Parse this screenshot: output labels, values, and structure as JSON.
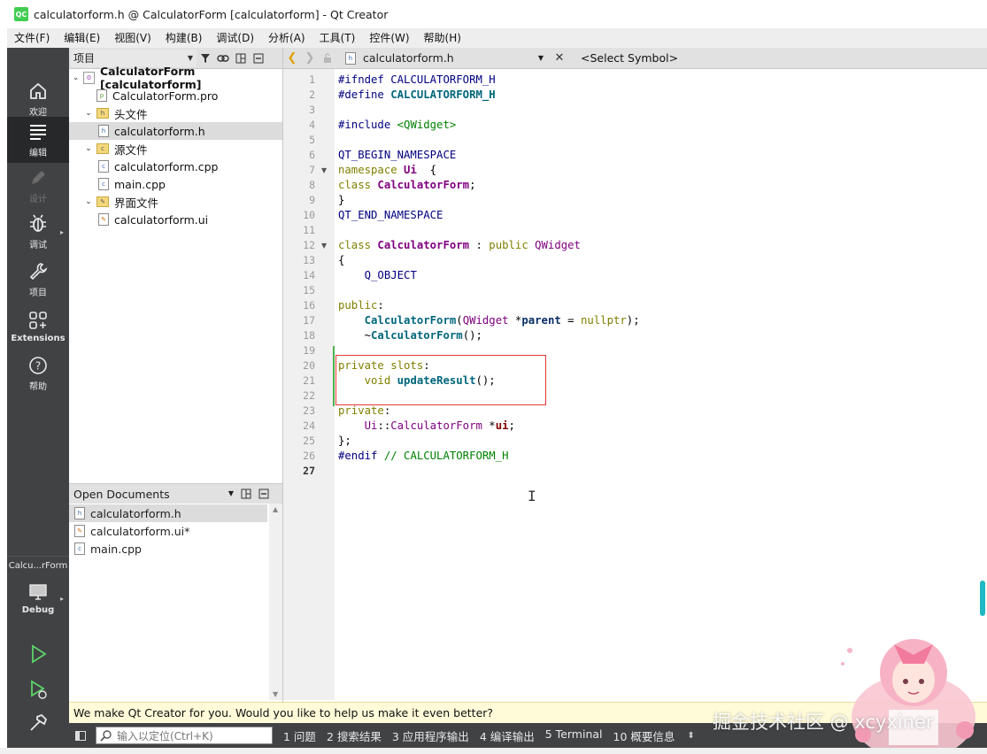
{
  "window": {
    "logo": "QC",
    "title": "calculatorform.h @ CalculatorForm [calculatorform] - Qt Creator"
  },
  "menu": [
    "文件(F)",
    "编辑(E)",
    "视图(V)",
    "构建(B)",
    "调试(D)",
    "分析(A)",
    "工具(T)",
    "控件(W)",
    "帮助(H)"
  ],
  "modes": {
    "welcome": "欢迎",
    "edit": "编辑",
    "design": "设计",
    "debug": "调试",
    "projects": "项目",
    "extensions": "Extensions",
    "help": "帮助"
  },
  "target": {
    "name": "Calcu...rForm",
    "config": "Debug"
  },
  "projects_panel": {
    "title": "项目",
    "tree": [
      {
        "label": "CalculatorForm [calculatorform]",
        "level": 0,
        "kind": "project",
        "expanded": true
      },
      {
        "label": "CalculatorForm.pro",
        "level": 1,
        "kind": "pro"
      },
      {
        "label": "头文件",
        "level": 1,
        "kind": "folder",
        "expanded": true
      },
      {
        "label": "calculatorform.h",
        "level": 2,
        "kind": "h",
        "selected": true
      },
      {
        "label": "源文件",
        "level": 1,
        "kind": "folder",
        "expanded": true
      },
      {
        "label": "calculatorform.cpp",
        "level": 2,
        "kind": "cpp"
      },
      {
        "label": "main.cpp",
        "level": 2,
        "kind": "cpp"
      },
      {
        "label": "界面文件",
        "level": 1,
        "kind": "folder",
        "expanded": true
      },
      {
        "label": "calculatorform.ui",
        "level": 2,
        "kind": "ui"
      }
    ]
  },
  "open_documents": {
    "title": "Open Documents",
    "items": [
      {
        "label": "calculatorform.h",
        "kind": "h",
        "selected": true
      },
      {
        "label": "calculatorform.ui*",
        "kind": "ui"
      },
      {
        "label": "main.cpp",
        "kind": "cpp"
      }
    ]
  },
  "editor_toolbar": {
    "file": "calculatorform.h",
    "symbol": "<Select Symbol>"
  },
  "editor": {
    "current_line": 27,
    "lines": [
      {
        "n": "1",
        "html": [
          [
            "pp",
            "#ifndef "
          ],
          [
            "mac",
            "CALCULATORFORM_H"
          ]
        ]
      },
      {
        "n": "2",
        "html": [
          [
            "pp",
            "#define "
          ],
          [
            "mac b",
            "CALCULATORFORM_H"
          ]
        ]
      },
      {
        "n": "3",
        "html": []
      },
      {
        "n": "4",
        "html": [
          [
            "pp",
            "#include "
          ],
          [
            "inc",
            "<QWidget>"
          ]
        ]
      },
      {
        "n": "5",
        "html": []
      },
      {
        "n": "6",
        "html": [
          [
            "mac",
            "QT_BEGIN_NAMESPACE"
          ]
        ]
      },
      {
        "n": "7",
        "html": [
          [
            "kw",
            "namespace "
          ],
          [
            "cls",
            "Ui"
          ],
          [
            "",
            "  {"
          ]
        ],
        "fold": true
      },
      {
        "n": "8",
        "html": [
          [
            "kw",
            "class "
          ],
          [
            "cls",
            "CalculatorForm"
          ],
          [
            "",
            ";"
          ]
        ]
      },
      {
        "n": "9",
        "html": [
          [
            "",
            "}"
          ]
        ]
      },
      {
        "n": "10",
        "html": [
          [
            "mac",
            "QT_END_NAMESPACE"
          ]
        ]
      },
      {
        "n": "11",
        "html": []
      },
      {
        "n": "12",
        "html": [
          [
            "kw",
            "class "
          ],
          [
            "cls",
            "CalculatorForm"
          ],
          [
            "",
            " : "
          ],
          [
            "kw",
            "public "
          ],
          [
            "cls2",
            "QWidget"
          ]
        ],
        "fold": true
      },
      {
        "n": "13",
        "html": [
          [
            "",
            "{"
          ]
        ]
      },
      {
        "n": "14",
        "html": [
          [
            "",
            "    "
          ],
          [
            "mac",
            "Q_OBJECT"
          ]
        ]
      },
      {
        "n": "15",
        "html": []
      },
      {
        "n": "16",
        "html": [
          [
            "kw",
            "public"
          ],
          [
            "",
            ":"
          ]
        ]
      },
      {
        "n": "17",
        "html": [
          [
            "",
            "    "
          ],
          [
            "fn",
            "CalculatorForm"
          ],
          [
            "",
            "("
          ],
          [
            "cls2",
            "QWidget"
          ],
          [
            "",
            " *"
          ],
          [
            "var2",
            "parent"
          ],
          [
            "",
            " = "
          ],
          [
            "kw",
            "nullptr"
          ],
          [
            "",
            ");"
          ]
        ]
      },
      {
        "n": "18",
        "html": [
          [
            "",
            "    ~"
          ],
          [
            "fn",
            "CalculatorForm"
          ],
          [
            "",
            "();"
          ]
        ]
      },
      {
        "n": "19",
        "html": []
      },
      {
        "n": "20",
        "html": [
          [
            "kw",
            "private slots"
          ],
          [
            "",
            ":"
          ]
        ]
      },
      {
        "n": "21",
        "html": [
          [
            "",
            "    "
          ],
          [
            "kw",
            "void "
          ],
          [
            "fn",
            "updateResult"
          ],
          [
            "",
            "();"
          ]
        ]
      },
      {
        "n": "22",
        "html": []
      },
      {
        "n": "23",
        "html": [
          [
            "kw",
            "private"
          ],
          [
            "",
            ":"
          ]
        ]
      },
      {
        "n": "24",
        "html": [
          [
            "",
            "    "
          ],
          [
            "cls2",
            "Ui"
          ],
          [
            "",
            "::"
          ],
          [
            "cls2",
            "CalculatorForm"
          ],
          [
            "",
            " *"
          ],
          [
            "var",
            "ui"
          ],
          [
            "",
            ";"
          ]
        ]
      },
      {
        "n": "25",
        "html": [
          [
            "",
            "};"
          ]
        ]
      },
      {
        "n": "26",
        "html": [
          [
            "pp",
            "#endif "
          ],
          [
            "cm",
            "// CALCULATORFORM_H"
          ]
        ]
      },
      {
        "n": "27",
        "html": []
      }
    ]
  },
  "infobar": {
    "message": "We make Qt Creator for you. Would you like to help us make it even better?"
  },
  "statusbar": {
    "locator_placeholder": "输入以定位(Ctrl+K)",
    "tabs": [
      "1  问题",
      "2  搜索结果",
      "3  应用程序输出",
      "4  编译输出",
      "5  Terminal",
      "10  概要信息"
    ]
  },
  "watermark": "掘金技术社区 @ xcyxiner"
}
